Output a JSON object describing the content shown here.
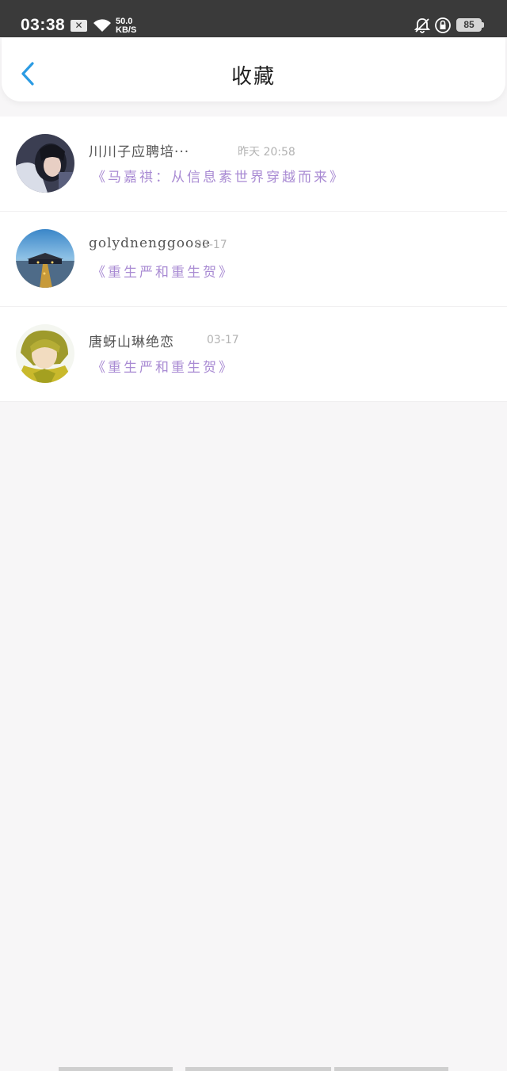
{
  "status_bar": {
    "time": "03:38",
    "network_speed_value": "50.0",
    "network_speed_unit": "KB/S",
    "battery_level": "85",
    "icons": [
      "x-notification-icon",
      "wifi-icon",
      "bell-off-icon",
      "rotation-lock-icon",
      "battery-icon"
    ]
  },
  "header": {
    "title": "收藏",
    "back_icon": "chevron-left-icon",
    "back_color": "#2b9be3"
  },
  "favorites": [
    {
      "author": "川川子应聘培···",
      "time": "昨天 20:58",
      "book": "《马嘉祺：从信息素世界穿越而来》"
    },
    {
      "author": "golydnenggoose",
      "time": "03-17",
      "book": "《重生严和重生贺》"
    },
    {
      "author": "唐蚜山琳绝恋",
      "time": "03-17",
      "book": "《重生严和重生贺》"
    }
  ],
  "colors": {
    "book_title": "#a98bd3",
    "background": "#f7f6f7"
  }
}
